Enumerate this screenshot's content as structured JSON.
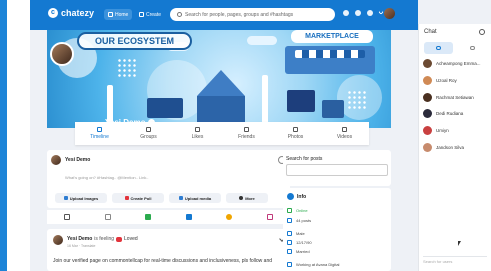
{
  "app": {
    "name": "chatezy",
    "nav": {
      "home": "Home",
      "create": "Create"
    },
    "search_placeholder": "Search for people, pages, groups and #hashtags"
  },
  "cover": {
    "ecosystem_label": "OUR ECOSYSTEM",
    "marketplace_label": "MARKETPLACE"
  },
  "profile": {
    "name": "Yesi Demo"
  },
  "tabs": [
    {
      "label": "Timeline",
      "icon": "timeline-icon"
    },
    {
      "label": "Groups",
      "icon": "groups-icon"
    },
    {
      "label": "Likes",
      "icon": "likes-icon"
    },
    {
      "label": "Friends",
      "icon": "friends-icon"
    },
    {
      "label": "Photos",
      "icon": "photos-icon"
    },
    {
      "label": "Videos",
      "icon": "videos-icon"
    }
  ],
  "composer": {
    "author": "Yesi Demo",
    "placeholder": "What's going on? #Hashtag.. @Mention.. Link..",
    "actions": [
      {
        "label": "Upload Images",
        "color": "#2f7dd1"
      },
      {
        "label": "Create Poll",
        "color": "#e2343c"
      },
      {
        "label": "Upload media",
        "color": "#2f7dd1"
      },
      {
        "label": "More",
        "color": "#333333"
      }
    ]
  },
  "filters": [
    {
      "icon": "all-posts-icon",
      "color": "#555555"
    },
    {
      "icon": "text-posts-icon",
      "color": "#888888"
    },
    {
      "icon": "image-posts-icon",
      "color": "#2bab4e"
    },
    {
      "icon": "video-posts-icon",
      "color": "#1479d1"
    },
    {
      "icon": "audio-posts-icon",
      "color": "#f0a500"
    },
    {
      "icon": "file-posts-icon",
      "color": "#c0397a"
    }
  ],
  "post": {
    "author": "Yesi Demo",
    "feeling_text": "is feeling",
    "feeling": "Loved",
    "time": "16 Mar · Translate",
    "body": "Join our verified page on commontellcap for real-time discussions and inclusiveness, pls follow and"
  },
  "sidebar": {
    "search_title": "Search for posts",
    "info_title": "Info",
    "rows": [
      {
        "text": "Online",
        "status": "on"
      },
      {
        "text": "44 posts",
        "status": ""
      },
      {
        "text": "Male",
        "status": ""
      },
      {
        "text": "12/17/90",
        "status": ""
      },
      {
        "text": "Married",
        "status": ""
      },
      {
        "text": "Working at Avana Digital",
        "status": ""
      }
    ]
  },
  "chat": {
    "title": "Chat",
    "contacts": [
      {
        "name": "Acheampong Emma...",
        "color": "#6b4a32"
      },
      {
        "name": "Uzoal Roy",
        "color": "#d08a55"
      },
      {
        "name": "Rachmat Setiawan",
        "color": "#4a3020"
      },
      {
        "name": "Dedi Rudiana",
        "color": "#2b2b3b"
      },
      {
        "name": "Umiyn",
        "color": "#c94040"
      },
      {
        "name": "Jandson Silva",
        "color": "#c78b6d"
      }
    ],
    "search_placeholder": "Search for users"
  },
  "colors": {
    "brand": "#1479d1",
    "accent_red": "#e2343c"
  }
}
